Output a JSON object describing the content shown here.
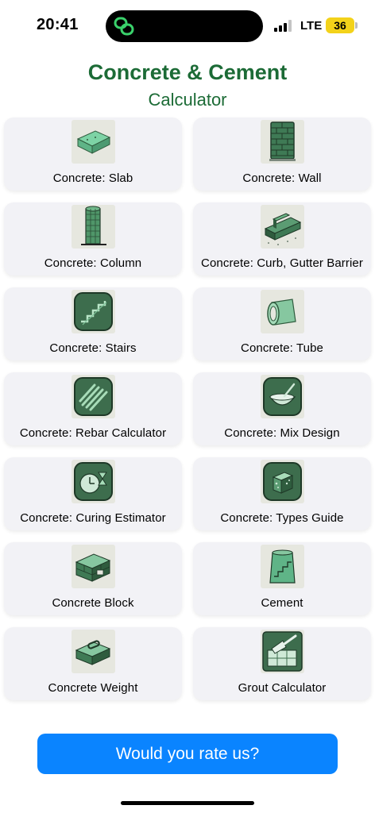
{
  "status": {
    "time": "20:41",
    "network": "LTE",
    "battery": "36"
  },
  "header": {
    "title": "Concrete & Cement",
    "subtitle": "Calculator"
  },
  "tiles": [
    {
      "label": "Concrete: Slab",
      "icon": "slab-icon"
    },
    {
      "label": "Concrete: Wall",
      "icon": "brick-wall-icon"
    },
    {
      "label": "Concrete: Column",
      "icon": "column-icon"
    },
    {
      "label": "Concrete: Curb, Gutter Barrier",
      "icon": "curb-icon"
    },
    {
      "label": "Concrete: Stairs",
      "icon": "stairs-icon"
    },
    {
      "label": "Concrete: Tube",
      "icon": "tube-icon"
    },
    {
      "label": "Concrete: Rebar Calculator",
      "icon": "rebar-icon"
    },
    {
      "label": "Concrete: Mix Design",
      "icon": "mixing-bowl-icon"
    },
    {
      "label": "Concrete: Curing Estimator",
      "icon": "hourglass-icon"
    },
    {
      "label": "Concrete: Types Guide",
      "icon": "cube-icon"
    },
    {
      "label": "Concrete Block",
      "icon": "concrete-block-icon"
    },
    {
      "label": "Cement",
      "icon": "cement-bag-icon"
    },
    {
      "label": "Concrete Weight",
      "icon": "weight-block-icon"
    },
    {
      "label": "Grout Calculator",
      "icon": "trowel-icon"
    }
  ],
  "rate_button": {
    "label": "Would you rate us?"
  },
  "colors": {
    "brand_green": "#1c6b36",
    "button_blue": "#0a84ff",
    "card_bg": "#f2f2f6",
    "battery_yellow": "#f3d21a"
  }
}
